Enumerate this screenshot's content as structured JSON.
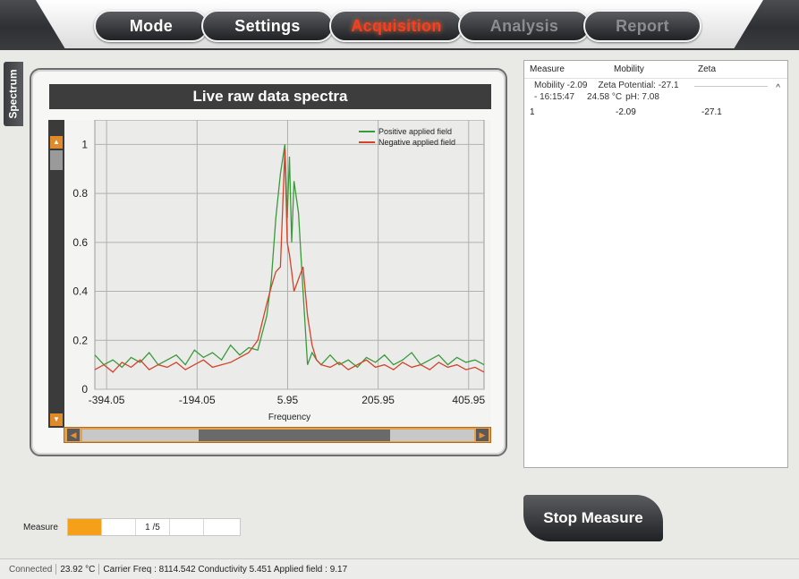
{
  "nav": {
    "tabs": [
      {
        "label": "Mode",
        "state": "enabled"
      },
      {
        "label": "Settings",
        "state": "enabled"
      },
      {
        "label": "Acquisition",
        "state": "active"
      },
      {
        "label": "Analysis",
        "state": "disabled"
      },
      {
        "label": "Report",
        "state": "disabled"
      }
    ]
  },
  "side_tab": {
    "label": "Spectrum"
  },
  "panel": {
    "title": "Live raw data spectra"
  },
  "chart_data": {
    "type": "line",
    "xlabel": "Frequency",
    "ylabel": "",
    "x_ticks": [
      "-394.05",
      "-194.05",
      "5.95",
      "205.95",
      "405.95"
    ],
    "y_ticks": [
      "0",
      "0.2",
      "0.4",
      "0.6",
      "0.8",
      "1"
    ],
    "xlim": [
      -420,
      440
    ],
    "ylim": [
      0,
      1.1
    ],
    "grid": true,
    "legend_position": "top-right",
    "series": [
      {
        "name": "Positive applied field",
        "color": "#3a9a3a",
        "x": [
          -420,
          -400,
          -380,
          -360,
          -340,
          -320,
          -300,
          -280,
          -260,
          -240,
          -220,
          -200,
          -180,
          -160,
          -140,
          -120,
          -100,
          -80,
          -60,
          -40,
          -30,
          -20,
          -10,
          0,
          5,
          10,
          15,
          20,
          30,
          40,
          50,
          60,
          70,
          80,
          100,
          120,
          140,
          160,
          180,
          200,
          220,
          240,
          260,
          280,
          300,
          320,
          340,
          360,
          380,
          400,
          420,
          440
        ],
        "y": [
          0.14,
          0.1,
          0.12,
          0.09,
          0.13,
          0.11,
          0.15,
          0.1,
          0.12,
          0.14,
          0.1,
          0.16,
          0.13,
          0.15,
          0.12,
          0.18,
          0.14,
          0.17,
          0.16,
          0.3,
          0.45,
          0.7,
          0.88,
          1.0,
          0.7,
          0.95,
          0.6,
          0.85,
          0.72,
          0.4,
          0.1,
          0.15,
          0.12,
          0.1,
          0.14,
          0.1,
          0.12,
          0.09,
          0.13,
          0.11,
          0.14,
          0.1,
          0.12,
          0.15,
          0.1,
          0.12,
          0.14,
          0.1,
          0.13,
          0.11,
          0.12,
          0.1
        ]
      },
      {
        "name": "Negative applied field",
        "color": "#d2442a",
        "x": [
          -420,
          -400,
          -380,
          -360,
          -340,
          -320,
          -300,
          -280,
          -260,
          -240,
          -220,
          -200,
          -180,
          -160,
          -140,
          -120,
          -100,
          -80,
          -60,
          -40,
          -30,
          -20,
          -10,
          0,
          5,
          10,
          15,
          20,
          30,
          40,
          50,
          60,
          70,
          80,
          100,
          120,
          140,
          160,
          180,
          200,
          220,
          240,
          260,
          280,
          300,
          320,
          340,
          360,
          380,
          400,
          420,
          440
        ],
        "y": [
          0.08,
          0.1,
          0.07,
          0.11,
          0.09,
          0.12,
          0.08,
          0.1,
          0.09,
          0.11,
          0.08,
          0.1,
          0.12,
          0.09,
          0.1,
          0.11,
          0.13,
          0.15,
          0.2,
          0.35,
          0.42,
          0.48,
          0.5,
          0.98,
          0.6,
          0.55,
          0.48,
          0.4,
          0.45,
          0.5,
          0.3,
          0.18,
          0.12,
          0.1,
          0.09,
          0.11,
          0.08,
          0.1,
          0.12,
          0.09,
          0.1,
          0.08,
          0.11,
          0.09,
          0.1,
          0.08,
          0.11,
          0.09,
          0.1,
          0.08,
          0.09,
          0.07
        ]
      }
    ]
  },
  "results": {
    "columns": [
      "Measure",
      "Mobility",
      "Zeta"
    ],
    "group": {
      "mobility": "Mobility -2.09",
      "zeta": "Zeta Potential:  -27.1",
      "time": "- 16:15:47",
      "temp": "24.58 °C",
      "ph": "pH: 7.08"
    },
    "rows": [
      {
        "measure": "1",
        "mobility": "-2.09",
        "zeta": "-27.1"
      }
    ]
  },
  "stop_button": {
    "label": "Stop Measure"
  },
  "measure_progress": {
    "label": "Measure",
    "current": "1 /5",
    "completed_fraction": 0.2
  },
  "status": {
    "connection": "Connected",
    "temperature": "23.92 °C",
    "details": "Carrier Freq : 8114.542 Conductivity 5.451 Applied field : 9.17"
  },
  "colors": {
    "accent": "#f5a019",
    "active_tab": "#ff3b1a"
  }
}
